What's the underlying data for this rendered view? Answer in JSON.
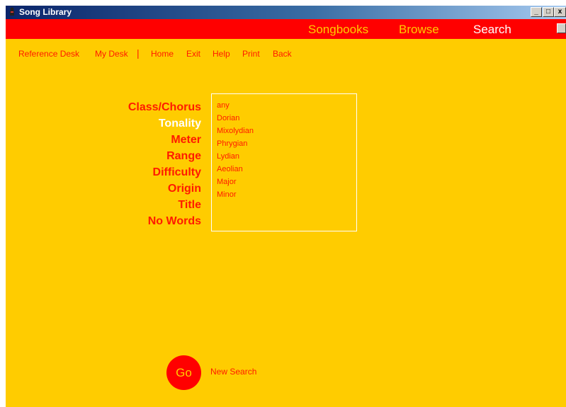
{
  "window": {
    "title": "Song Library",
    "controls": [
      "_",
      "□",
      "x"
    ]
  },
  "nav": {
    "songbooks": "Songbooks",
    "browse": "Browse",
    "search": "Search"
  },
  "toplinks": {
    "reference_desk": "Reference Desk",
    "my_desk": "My Desk",
    "separator": "|",
    "home": "Home",
    "exit": "Exit",
    "help": "Help",
    "print": "Print",
    "back": "Back"
  },
  "criteria": [
    "Class/Chorus",
    "Tonality",
    "Meter",
    "Range",
    "Difficulty",
    "Origin",
    "Title",
    "No Words"
  ],
  "selected_criterion": "Tonality",
  "tonality_options": [
    "any",
    "Dorian",
    "Mixolydian",
    "Phrygian",
    "Lydian",
    "Aeolian",
    "Major",
    "Minor"
  ],
  "go_label": "Go",
  "new_search_label": "New Search",
  "colors": {
    "background": "#ffcc00",
    "menubar": "#ff0000",
    "text_red": "#ff1a00",
    "selected": "#ffffff"
  }
}
